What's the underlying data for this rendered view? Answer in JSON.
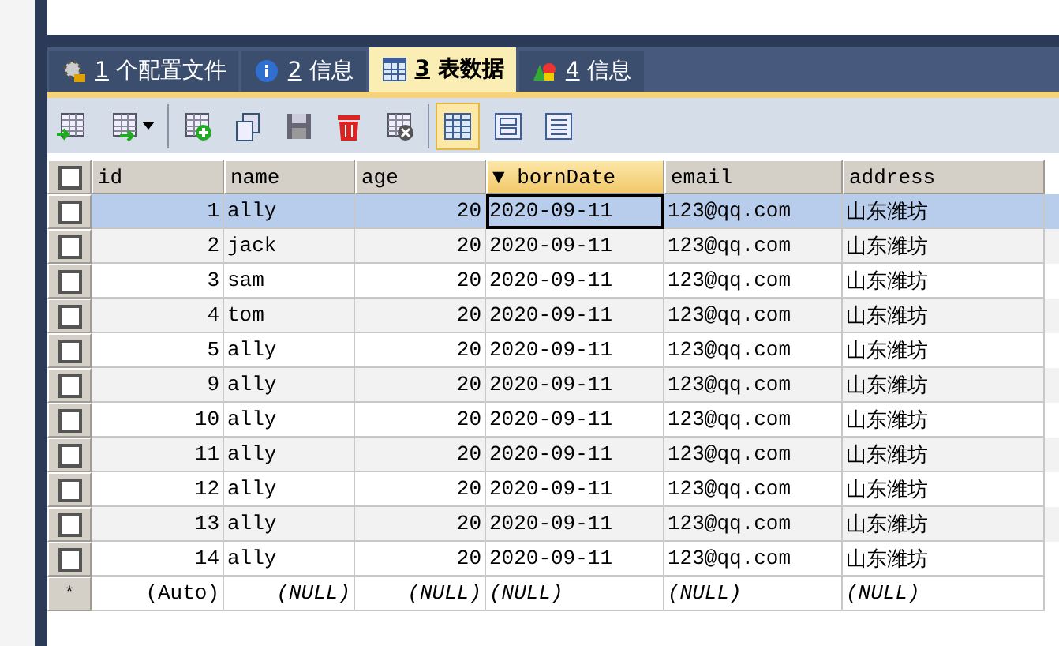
{
  "tabs": [
    {
      "key": "1",
      "label": "个配置文件",
      "selected": false
    },
    {
      "key": "2",
      "label": "信息",
      "selected": false
    },
    {
      "key": "3",
      "label": "表数据",
      "selected": true
    },
    {
      "key": "4",
      "label": "信息",
      "selected": false
    }
  ],
  "toolbar": [
    {
      "kind": "import",
      "selected": false
    },
    {
      "kind": "export",
      "selected": false
    },
    {
      "kind": "sep"
    },
    {
      "kind": "add",
      "selected": false
    },
    {
      "kind": "copy",
      "selected": false
    },
    {
      "kind": "save",
      "selected": false
    },
    {
      "kind": "delete",
      "selected": false
    },
    {
      "kind": "cancel",
      "selected": false
    },
    {
      "kind": "sep"
    },
    {
      "kind": "grid",
      "selected": true
    },
    {
      "kind": "form",
      "selected": false
    },
    {
      "kind": "text",
      "selected": false
    }
  ],
  "table": {
    "all_checked": false,
    "columns": [
      {
        "label": "id",
        "sorted": false
      },
      {
        "label": "name",
        "sorted": false
      },
      {
        "label": "age",
        "sorted": false
      },
      {
        "label": "▼ bornDate",
        "sorted": true
      },
      {
        "label": "email",
        "sorted": false
      },
      {
        "label": "address",
        "sorted": false
      }
    ],
    "rows": [
      {
        "selected": true,
        "checked": false,
        "cells": [
          "1",
          "ally",
          "20",
          "2020-09-11",
          "123@qq.com",
          "山东潍坊"
        ]
      },
      {
        "selected": false,
        "checked": false,
        "cells": [
          "2",
          "jack",
          "20",
          "2020-09-11",
          "123@qq.com",
          "山东潍坊"
        ]
      },
      {
        "selected": false,
        "checked": false,
        "cells": [
          "3",
          "sam",
          "20",
          "2020-09-11",
          "123@qq.com",
          "山东潍坊"
        ]
      },
      {
        "selected": false,
        "checked": false,
        "cells": [
          "4",
          "tom",
          "20",
          "2020-09-11",
          "123@qq.com",
          "山东潍坊"
        ]
      },
      {
        "selected": false,
        "checked": false,
        "cells": [
          "5",
          "ally",
          "20",
          "2020-09-11",
          "123@qq.com",
          "山东潍坊"
        ]
      },
      {
        "selected": false,
        "checked": false,
        "cells": [
          "9",
          "ally",
          "20",
          "2020-09-11",
          "123@qq.com",
          "山东潍坊"
        ]
      },
      {
        "selected": false,
        "checked": false,
        "cells": [
          "10",
          "ally",
          "20",
          "2020-09-11",
          "123@qq.com",
          "山东潍坊"
        ]
      },
      {
        "selected": false,
        "checked": false,
        "cells": [
          "11",
          "ally",
          "20",
          "2020-09-11",
          "123@qq.com",
          "山东潍坊"
        ]
      },
      {
        "selected": false,
        "checked": false,
        "cells": [
          "12",
          "ally",
          "20",
          "2020-09-11",
          "123@qq.com",
          "山东潍坊"
        ]
      },
      {
        "selected": false,
        "checked": false,
        "cells": [
          "13",
          "ally",
          "20",
          "2020-09-11",
          "123@qq.com",
          "山东潍坊"
        ]
      },
      {
        "selected": false,
        "checked": false,
        "cells": [
          "14",
          "ally",
          "20",
          "2020-09-11",
          "123@qq.com",
          "山东潍坊"
        ]
      }
    ],
    "new_row": {
      "marker": "*",
      "cells": [
        "(Auto)",
        "(NULL)",
        "(NULL)",
        "(NULL)",
        "(NULL)",
        "(NULL)"
      ]
    }
  }
}
